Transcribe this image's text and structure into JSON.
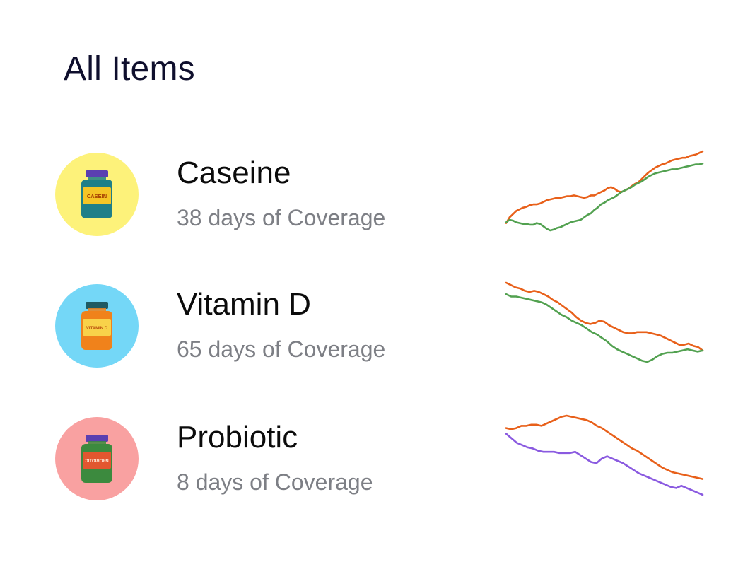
{
  "page": {
    "title": "All Items"
  },
  "items": [
    {
      "name": "Caseine",
      "coverage": "38 days of Coverage",
      "icon": "casein-jar-icon",
      "avatar_color": "#fdf27a",
      "bottle": {
        "body": "#1f7f88",
        "cap": "#5b3fb1",
        "label": "#f5c526",
        "label_text": "CASEIN",
        "text_color": "#a33a00",
        "mirror": false
      },
      "spark": [
        {
          "color": "#e8601a",
          "values": [
            2,
            9,
            13,
            17,
            19,
            21,
            22,
            24,
            25,
            25,
            26,
            28,
            30,
            31,
            32,
            33,
            33,
            34,
            35,
            35,
            36,
            35,
            34,
            33,
            34,
            36,
            36,
            38,
            40,
            42,
            45,
            46,
            44,
            41,
            40,
            42,
            44,
            47,
            50,
            52,
            56,
            60,
            64,
            67,
            70,
            72,
            74,
            75,
            77,
            79,
            80,
            81,
            82,
            82,
            84,
            85,
            86,
            88,
            90
          ]
        },
        {
          "color": "#52a150",
          "values": [
            3,
            6,
            5,
            3,
            2,
            1,
            1,
            0,
            0,
            2,
            1,
            -2,
            -5,
            -7,
            -6,
            -4,
            -3,
            -1,
            1,
            3,
            4,
            5,
            6,
            9,
            12,
            14,
            18,
            21,
            25,
            27,
            30,
            32,
            34,
            37,
            40,
            42,
            44,
            46,
            49,
            51,
            53,
            56,
            59,
            61,
            63,
            64,
            65,
            66,
            67,
            68,
            68,
            69,
            70,
            71,
            72,
            73,
            74,
            74,
            75
          ]
        }
      ]
    },
    {
      "name": "Vitamin D",
      "coverage": "65 days of Coverage",
      "icon": "vitamin-d-bottle-icon",
      "avatar_color": "#74d7f7",
      "bottle": {
        "body": "#f0821b",
        "cap": "#1f5a63",
        "label": "#f8d24a",
        "label_text": "VITAMIN D",
        "text_color": "#b5460a",
        "mirror": false
      },
      "spark": [
        {
          "color": "#e8601a",
          "values": [
            90,
            88,
            86,
            85,
            83,
            82,
            83,
            82,
            80,
            78,
            75,
            73,
            70,
            67,
            64,
            60,
            57,
            55,
            54,
            55,
            57,
            56,
            53,
            51,
            49,
            47,
            46,
            46,
            47,
            47,
            47,
            46,
            45,
            44,
            42,
            40,
            38,
            36,
            36,
            37,
            35,
            34,
            31
          ]
        },
        {
          "color": "#52a150",
          "values": [
            80,
            78,
            78,
            77,
            76,
            75,
            74,
            73,
            71,
            68,
            65,
            62,
            60,
            57,
            55,
            53,
            50,
            47,
            45,
            42,
            39,
            35,
            32,
            30,
            28,
            26,
            24,
            22,
            21,
            23,
            26,
            28,
            29,
            29,
            30,
            31,
            32,
            31,
            30,
            31
          ]
        }
      ]
    },
    {
      "name": "Probiotic",
      "coverage": "8 days of Coverage",
      "icon": "probiotic-bottle-icon",
      "avatar_color": "#f9a1a1",
      "bottle": {
        "body": "#3c8a3e",
        "cap": "#5b3fb1",
        "label": "#e2562f",
        "label_text": "PROBIOTIC",
        "text_color": "#ffe9d8",
        "mirror": true
      },
      "spark": [
        {
          "color": "#e8601a",
          "values": [
            75,
            74,
            75,
            77,
            77,
            78,
            78,
            77,
            79,
            81,
            83,
            85,
            86,
            85,
            84,
            83,
            82,
            80,
            77,
            75,
            72,
            69,
            66,
            63,
            60,
            57,
            55,
            52,
            49,
            46,
            43,
            40,
            38,
            36,
            35,
            34,
            33,
            32,
            31,
            30
          ]
        },
        {
          "color": "#8a5ae0",
          "values": [
            70,
            66,
            62,
            60,
            58,
            57,
            55,
            54,
            54,
            54,
            53,
            53,
            53,
            54,
            51,
            48,
            45,
            44,
            48,
            50,
            48,
            46,
            44,
            41,
            38,
            35,
            33,
            31,
            29,
            27,
            25,
            23,
            22,
            24,
            22,
            20,
            18,
            16
          ]
        }
      ]
    }
  ]
}
